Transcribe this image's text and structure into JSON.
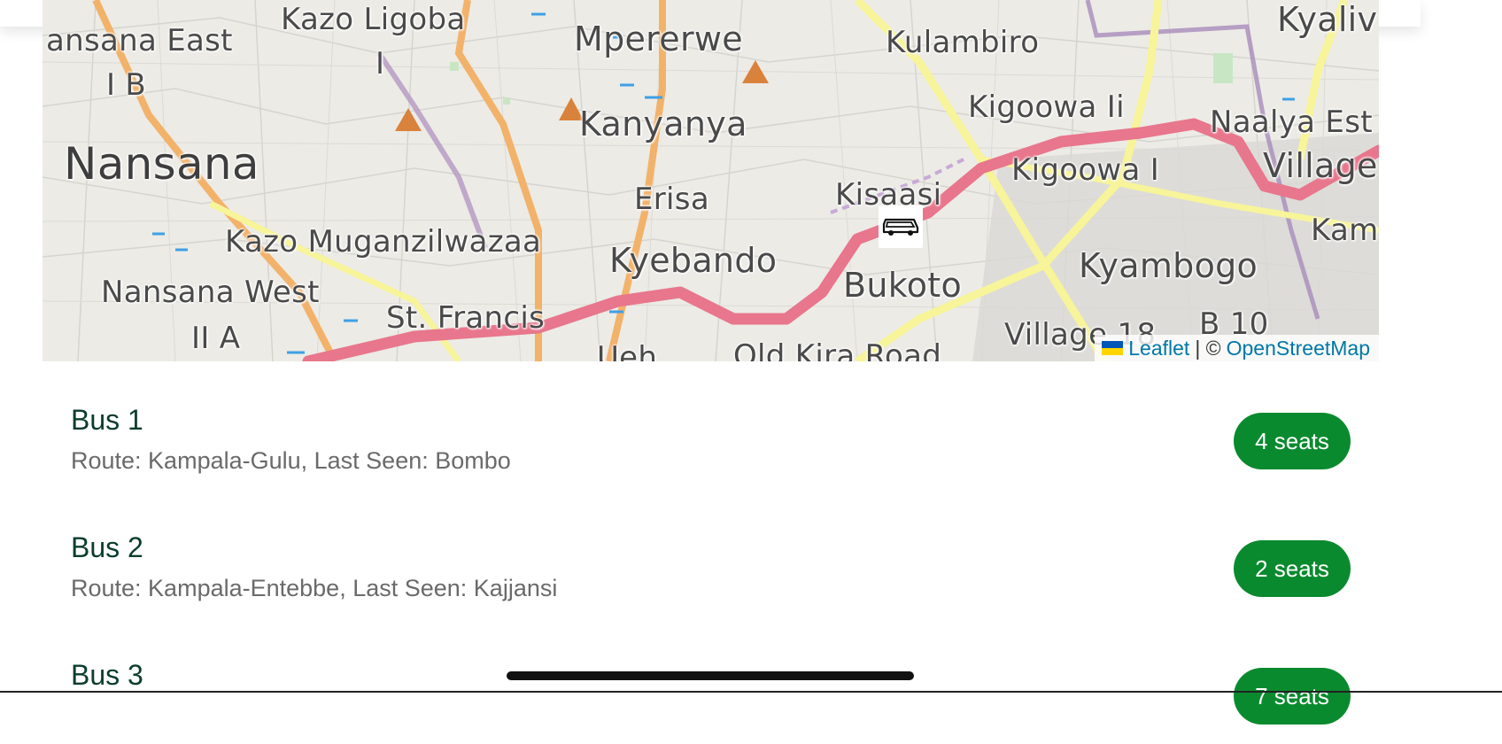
{
  "map": {
    "labels": [
      {
        "text": "Kazo Ligoba"
      },
      {
        "text": "I"
      },
      {
        "text": "ansana East"
      },
      {
        "text": "I B"
      },
      {
        "text": "Nansana"
      },
      {
        "text": "Kazo Muganzilwazaa"
      },
      {
        "text": "Nansana West"
      },
      {
        "text": "II A"
      },
      {
        "text": "St. Francis"
      },
      {
        "text": "Mpererwe"
      },
      {
        "text": "Kanyanya"
      },
      {
        "text": "Erisa"
      },
      {
        "text": "Kyebando"
      },
      {
        "text": "Kulambiro"
      },
      {
        "text": "Kigoowa Ii"
      },
      {
        "text": "Kigoowa I"
      },
      {
        "text": "Kisaasi"
      },
      {
        "text": "Bukoto"
      },
      {
        "text": "Kyambogo"
      },
      {
        "text": "Naalya Est"
      },
      {
        "text": "Village"
      },
      {
        "text": "Kyaliv"
      },
      {
        "text": "Kam"
      },
      {
        "text": "Village 18"
      },
      {
        "text": "B 10"
      },
      {
        "text": "Old Kira Road"
      },
      {
        "text": "Ueh"
      }
    ],
    "marker_icon": "bus-icon",
    "attribution": {
      "leaflet_label": "Leaflet",
      "separator": "| ©",
      "osm_label": "OpenStreetMap"
    }
  },
  "buses": [
    {
      "name": "Bus 1",
      "meta": "Route: Kampala-Gulu, Last Seen: Bombo",
      "seats": "4 seats"
    },
    {
      "name": "Bus 2",
      "meta": "Route: Kampala-Entebbe, Last Seen: Kajjansi",
      "seats": "2 seats"
    },
    {
      "name": "Bus 3",
      "meta": "",
      "seats": "7 seats"
    }
  ],
  "colors": {
    "accent": "#0a8a2e",
    "bus_name": "#0b3d2c",
    "link": "#0078a8",
    "primary_road": "#e8768c",
    "secondary_road": "#f7f49a",
    "tertiary_road": "#f2b26a"
  }
}
